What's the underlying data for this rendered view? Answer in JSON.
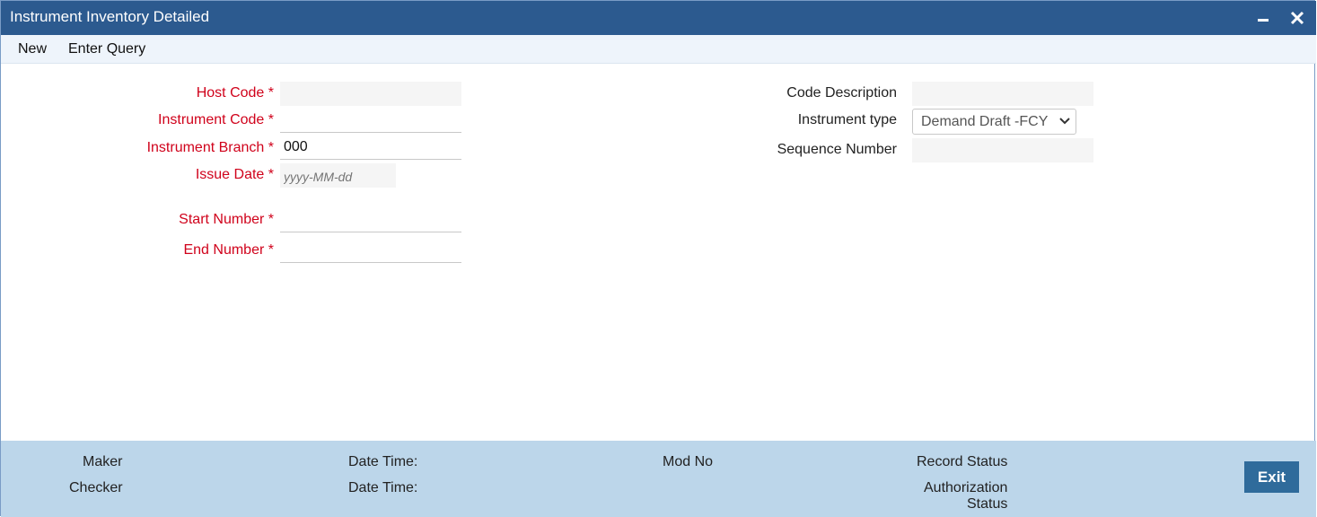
{
  "window": {
    "title": "Instrument Inventory Detailed",
    "minimize_icon": "minimize-icon",
    "close_icon": "close-icon"
  },
  "menu": {
    "items": [
      {
        "label": "New"
      },
      {
        "label": "Enter Query"
      }
    ]
  },
  "form": {
    "host_code": {
      "label": "Host Code",
      "required": "*",
      "value": ""
    },
    "instrument_code": {
      "label": "Instrument Code",
      "required": "*",
      "value": ""
    },
    "instrument_branch": {
      "label": "Instrument Branch",
      "required": "*",
      "value": "000"
    },
    "issue_date": {
      "label": "Issue Date",
      "required": "*",
      "placeholder": "yyyy-MM-dd"
    },
    "start_number": {
      "label": "Start Number",
      "required": "*",
      "value": ""
    },
    "end_number": {
      "label": "End Number",
      "required": "*",
      "value": ""
    },
    "code_description": {
      "label": "Code Description",
      "value": ""
    },
    "instrument_type": {
      "label": "Instrument type",
      "selected": "Demand Draft -FCY"
    },
    "sequence_number": {
      "label": "Sequence Number",
      "value": ""
    }
  },
  "footer": {
    "maker_label": "Maker",
    "checker_label": "Checker",
    "maker_datetime_label": "Date Time:",
    "checker_datetime_label": "Date Time:",
    "mod_no_label": "Mod No",
    "record_status_label": "Record Status",
    "authorization_label_line1": "Authorization",
    "authorization_label_line2": "Status",
    "exit_label": "Exit"
  },
  "colors": {
    "titlebar": "#2c5a8f",
    "required": "#d0021b",
    "footer": "#bcd6ea",
    "exit_button": "#2f6b9b"
  }
}
